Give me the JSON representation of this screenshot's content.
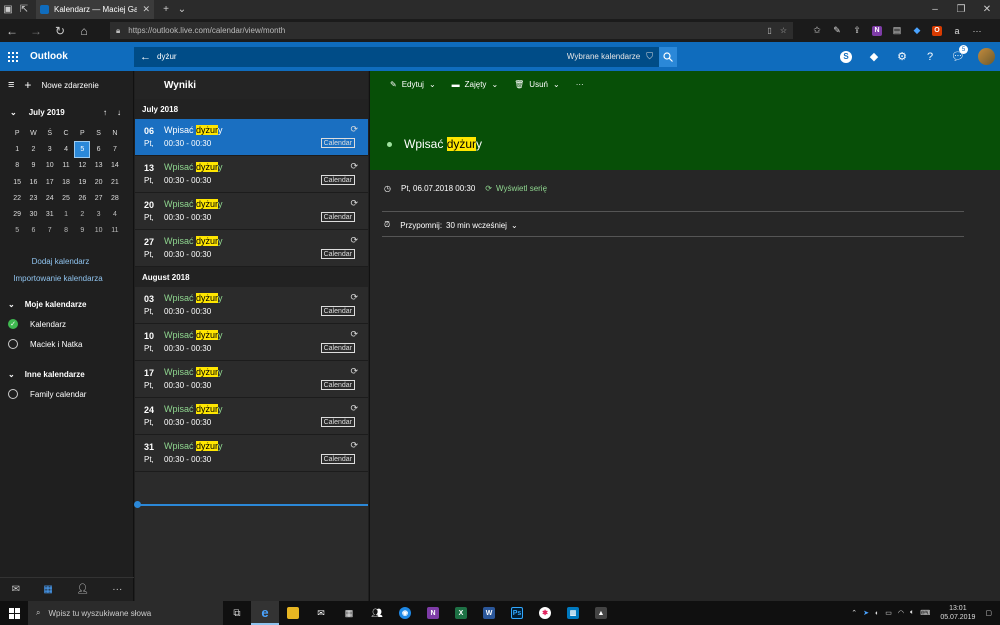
{
  "browser": {
    "tab_title": "Kalendarz — Maciej Gaj",
    "url": "https://outlook.live.com/calendar/view/month"
  },
  "header": {
    "brand": "Outlook",
    "search_query": "dyżur",
    "search_scope": "Wybrane kalendarze",
    "notification_count": "5"
  },
  "left": {
    "new_event": "Nowe zdarzenie",
    "month_label": "July 2019",
    "weekdays": [
      "P",
      "W",
      "Ś",
      "C",
      "P",
      "S",
      "N"
    ],
    "days": [
      [
        "1",
        "2",
        "3",
        "4",
        "5",
        "6",
        "7"
      ],
      [
        "8",
        "9",
        "10",
        "11",
        "12",
        "13",
        "14"
      ],
      [
        "15",
        "16",
        "17",
        "18",
        "19",
        "20",
        "21"
      ],
      [
        "22",
        "23",
        "24",
        "25",
        "26",
        "27",
        "28"
      ],
      [
        "29",
        "30",
        "31",
        "1",
        "2",
        "3",
        "4"
      ],
      [
        "5",
        "6",
        "7",
        "8",
        "9",
        "10",
        "11"
      ]
    ],
    "add_calendar": "Dodaj kalendarz",
    "import_calendar": "Importowanie kalendarza",
    "my_calendars_title": "Moje kalendarze",
    "my_calendars": [
      "Kalendarz",
      "Maciek i Natka"
    ],
    "other_calendars_title": "Inne kalendarze",
    "other_calendars": [
      "Family calendar"
    ]
  },
  "results": {
    "title": "Wyniki",
    "groups": [
      {
        "month": "July 2018",
        "events": [
          {
            "day": "06",
            "weekday": "Pt,",
            "pre": "Wpisać ",
            "hit": "dyżur",
            "post": "y",
            "time": "00:30 - 00:30",
            "badge": "Calendar"
          },
          {
            "day": "13",
            "weekday": "Pt,",
            "pre": "Wpisać ",
            "hit": "dyżur",
            "post": "y",
            "time": "00:30 - 00:30",
            "badge": "Calendar"
          },
          {
            "day": "20",
            "weekday": "Pt,",
            "pre": "Wpisać ",
            "hit": "dyżur",
            "post": "y",
            "time": "00:30 - 00:30",
            "badge": "Calendar"
          },
          {
            "day": "27",
            "weekday": "Pt,",
            "pre": "Wpisać ",
            "hit": "dyżur",
            "post": "y",
            "time": "00:30 - 00:30",
            "badge": "Calendar"
          }
        ]
      },
      {
        "month": "August 2018",
        "events": [
          {
            "day": "03",
            "weekday": "Pt,",
            "pre": "Wpisać ",
            "hit": "dyżur",
            "post": "y",
            "time": "00:30 - 00:30",
            "badge": "Calendar"
          },
          {
            "day": "10",
            "weekday": "Pt,",
            "pre": "Wpisać ",
            "hit": "dyżur",
            "post": "y",
            "time": "00:30 - 00:30",
            "badge": "Calendar"
          },
          {
            "day": "17",
            "weekday": "Pt,",
            "pre": "Wpisać ",
            "hit": "dyżur",
            "post": "y",
            "time": "00:30 - 00:30",
            "badge": "Calendar"
          },
          {
            "day": "24",
            "weekday": "Pt,",
            "pre": "Wpisać ",
            "hit": "dyżur",
            "post": "y",
            "time": "00:30 - 00:30",
            "badge": "Calendar"
          },
          {
            "day": "31",
            "weekday": "Pt,",
            "pre": "Wpisać ",
            "hit": "dyżur",
            "post": "y",
            "time": "00:30 - 00:30",
            "badge": "Calendar"
          }
        ]
      }
    ]
  },
  "detail": {
    "toolbar": {
      "edit": "Edytuj",
      "busy": "Zajęty",
      "delete": "Usuń",
      "more": "···"
    },
    "title_pre": "Wpisać ",
    "title_hit": "dyżur",
    "title_post": "y",
    "datetime": "Pt, 06.07.2018 00:30",
    "series_link": "Wyświetl serię",
    "reminder_label": "Przypomnij:",
    "reminder_value": "30 min wcześniej"
  },
  "taskbar": {
    "search_placeholder": "Wpisz tu wyszukiwane słowa",
    "time": "13:01",
    "date": "05.07.2019"
  },
  "colors": {
    "outlook_blue": "#0f6cbd",
    "selected_row": "#1a6fc1",
    "event_header_green": "#074f07",
    "highlight": "#ffe600",
    "event_title_green": "#8fd68f"
  }
}
